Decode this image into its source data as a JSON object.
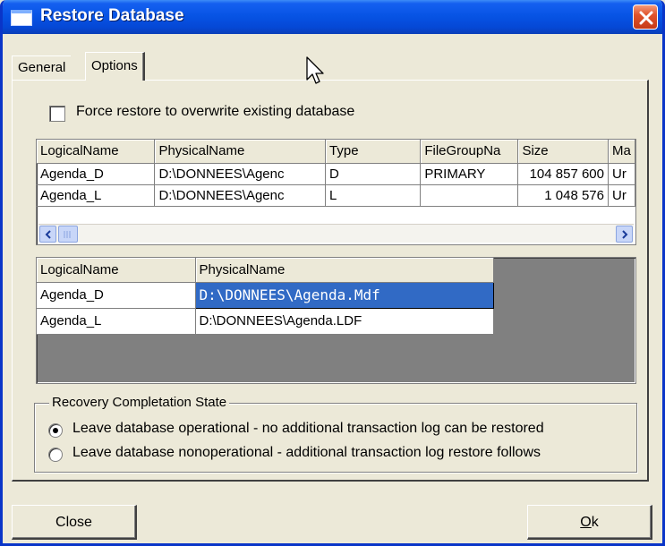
{
  "window": {
    "title": "Restore Database"
  },
  "tabs": [
    {
      "label": "General"
    },
    {
      "label": "Options"
    }
  ],
  "options": {
    "force_restore_label": "Force restore to overwrite existing database",
    "force_restore_checked": false
  },
  "files_table": {
    "columns": [
      "LogicalName",
      "PhysicalName",
      "Type",
      "FileGroupNa",
      "Size",
      "Ma"
    ],
    "rows": [
      [
        "Agenda_D",
        "D:\\DONNEES\\Agenc",
        "D",
        "PRIMARY",
        "104 857 600",
        "Ur"
      ],
      [
        "Agenda_L",
        "D:\\DONNEES\\Agenc",
        "L",
        "",
        "1 048 576",
        "Ur"
      ]
    ]
  },
  "mapping_table": {
    "columns": [
      "LogicalName",
      "PhysicalName"
    ],
    "rows": [
      [
        "Agenda_D",
        "D:\\DONNEES\\Agenda.Mdf"
      ],
      [
        "Agenda_L",
        "D:\\DONNEES\\Agenda.LDF"
      ]
    ]
  },
  "recovery": {
    "legend": "Recovery Completation State",
    "options": [
      {
        "label": "Leave database operational - no additional transaction log can be restored",
        "selected": true
      },
      {
        "label": "Leave database nonoperational - additional transaction log restore follows",
        "selected": false
      }
    ]
  },
  "buttons": {
    "close": "Close",
    "ok_hotkey": "O",
    "ok_rest": "k"
  },
  "colors": {
    "titlebar": "#0754e5",
    "selection": "#316ac5",
    "close_button": "#e0542c"
  }
}
